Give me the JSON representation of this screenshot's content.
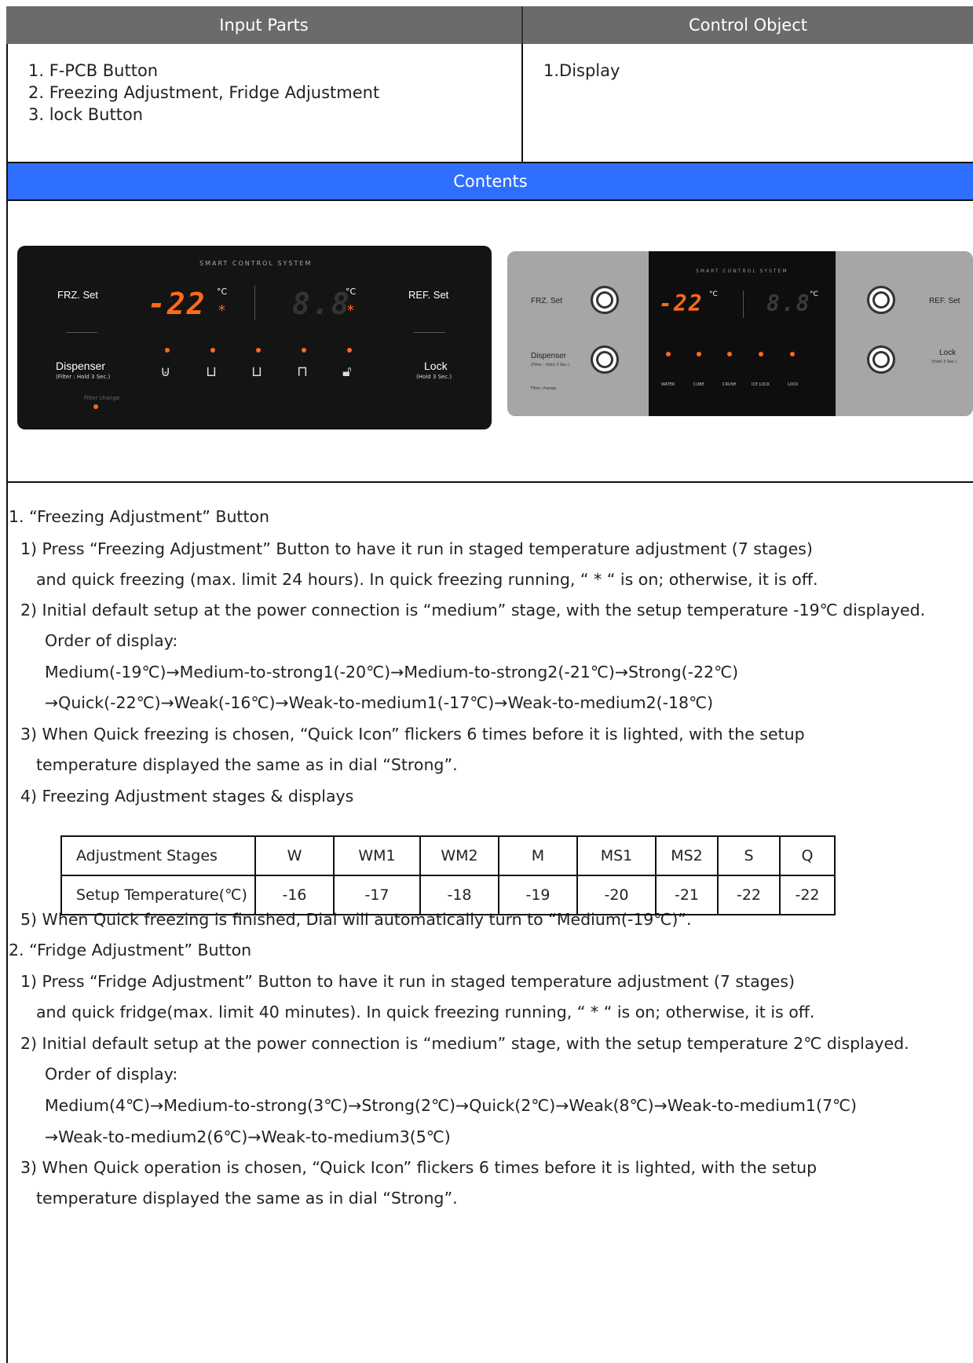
{
  "header": {
    "left": "Input Parts",
    "right": "Control Object"
  },
  "input_parts": [
    "1. F-PCB Button",
    "2. Freezing Adjustment, Fridge Adjustment",
    "3. lock Button"
  ],
  "control_object": [
    "1.Display"
  ],
  "contents_label": "Contents",
  "panel1": {
    "system_title": "SMART CONTROL SYSTEM",
    "frz": "FRZ. Set",
    "ref": "REF. Set",
    "dispenser": "Dispenser",
    "dispenser_sub": "(Filter : Hold 3 Sec.)",
    "lock": "Lock",
    "lock_sub": "(Hold 3 Sec.)",
    "filter_change": "Filter change",
    "left_temp": "-22",
    "right_temp": "8.8",
    "unit": "°C",
    "star": "*"
  },
  "panel2": {
    "system_title": "SMART CONTROL SYSTEM",
    "frz": "FRZ. Set",
    "ref": "REF. Set",
    "dispenser": "Dispenser",
    "dispenser_sub": "(Filter : Hold 3 Sec.)",
    "lock": "Lock",
    "lock_sub": "(Hold 3 Sec.)",
    "filter_change": "Filter change",
    "left_temp": "-22",
    "right_temp": "8.8",
    "unit": "°C",
    "icon_labels": [
      "WATER",
      "CUBE",
      "CRUSH",
      "ICE LOCK",
      "LOCK"
    ]
  },
  "body": {
    "s1_title": "1. “Freezing Adjustment” Button",
    "s1_1a": "1) Press “Freezing Adjustment” Button to have it run in staged temperature adjustment (7 stages)",
    "s1_1b": "and quick freezing (max. limit 24 hours). In quick freezing running, “ * “ is on; otherwise, it is off.",
    "s1_2a": "2) Initial default setup at the power connection is “medium” stage, with the setup temperature -19℃ displayed.",
    "s1_2b": "Order of display:",
    "s1_2c": "Medium(-19℃)→Medium-to-strong1(-20℃)→Medium-to-strong2(-21℃)→Strong(-22℃)",
    "s1_2d": "→Quick(-22℃)→Weak(-16℃)→Weak-to-medium1(-17℃)→Weak-to-medium2(-18℃)",
    "s1_3a": "3) When Quick freezing is chosen, “Quick Icon” flickers 6 times before it is lighted, with the setup",
    "s1_3b": "temperature displayed the same as in dial “Strong”.",
    "s1_4": "4) Freezing Adjustment stages & displays",
    "s1_5": "5) When Quick freezing is finished, Dial will automatically turn to “Medium(-19℃)”.",
    "s2_title": "2. “Fridge Adjustment” Button",
    "s2_1a": "1) Press “Fridge Adjustment” Button to have it run in staged temperature adjustment (7 stages)",
    "s2_1b": "and quick fridge(max. limit 40 minutes). In quick freezing running, “ * “ is on; otherwise, it is off.",
    "s2_2a": "2) Initial default setup at the power connection is “medium” stage, with the setup temperature 2℃ displayed.",
    "s2_2b": "Order of display:",
    "s2_2c": "Medium(4℃)→Medium-to-strong(3℃)→Strong(2℃)→Quick(2℃)→Weak(8℃)→Weak-to-medium1(7℃)",
    "s2_2d": "→Weak-to-medium2(6℃)→Weak-to-medium3(5℃)",
    "s2_3a": "3) When Quick operation is chosen, “Quick Icon” flickers 6 times before it is lighted, with the setup",
    "s2_3b": "temperature displayed the same as in dial “Strong”."
  },
  "stage_table": {
    "row1_label": "Adjustment Stages",
    "row2_label": "Setup Temperature(℃)",
    "stages": [
      "W",
      "WM1",
      "WM2",
      "M",
      "MS1",
      "MS2",
      "S",
      "Q"
    ],
    "temps": [
      "-16",
      "-17",
      "-18",
      "-19",
      "-20",
      "-21",
      "-22",
      "-22"
    ]
  }
}
